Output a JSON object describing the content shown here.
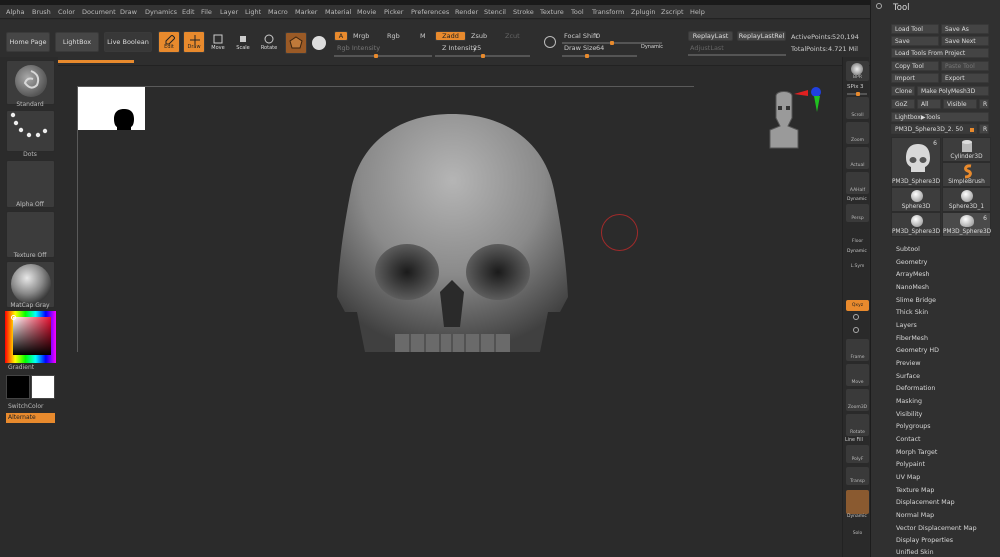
{
  "colors": {
    "accent": "#e88a2d",
    "background": "#2b2b2b",
    "panel": "#303030",
    "axis_red": "#e02020",
    "axis_green": "#20c020",
    "axis_blue": "#2040e0"
  },
  "menubar": {
    "items": [
      "Alpha",
      "Brush",
      "Color",
      "Document",
      "Draw",
      "Dynamics",
      "Edit",
      "File",
      "Layer",
      "Light",
      "Macro",
      "Marker",
      "Material",
      "Movie",
      "Picker",
      "Preferences",
      "Render",
      "Stencil",
      "Stroke",
      "Texture",
      "Tool",
      "Transform",
      "Zplugin",
      "Zscript",
      "Help"
    ]
  },
  "top_shelf": {
    "home_page": "Home Page",
    "lightbox": "LightBox",
    "live_boolean": "Live Boolean",
    "edit": "Edit",
    "draw": "Draw",
    "move": "Move",
    "scale": "Scale",
    "rotate": "Rotate",
    "a": "A",
    "mrgb": "Mrgb",
    "rgb": "Rgb",
    "m": "M",
    "rgb_intensity": "Rgb Intensity",
    "zadd": "Zadd",
    "zsub": "Zsub",
    "zcut": "Zcut",
    "z_intensity_label": "Z Intensity",
    "z_intensity_value": "25",
    "focal_shift_label": "Focal Shift",
    "focal_shift_value": "0",
    "draw_size_label": "Draw Size",
    "draw_size_value": "64",
    "dynamic": "Dynamic",
    "replay_last": "ReplayLast",
    "replay_last_rel": "ReplayLastRel",
    "adjust_last": "AdjustLast",
    "active_points_label": "ActivePoints:",
    "active_points_value": "520,194",
    "total_points_label": "TotalPoints:",
    "total_points_value": "4.721 Mil"
  },
  "left_shelf": {
    "brush": "Standard",
    "stroke": "Dots",
    "alpha": "Alpha Off",
    "texture": "Texture Off",
    "material": "MatCap Gray",
    "gradient": "Gradient",
    "switch_color": "SwitchColor",
    "alternate": "Alternate"
  },
  "right_shelf": {
    "bpr": "BPR",
    "spix_label": "SPix",
    "spix_value": "3",
    "scroll": "Scroll",
    "zoom": "Zoom",
    "actual": "Actual",
    "aahalf": "AAHalf",
    "dynamic": "Dynamic",
    "persp": "Persp",
    "floor": "Floor",
    "dynamic2": "Dynamic",
    "lsym": "L.Sym",
    "xyz": "Qxyz",
    "frame": "Frame",
    "move": "Move",
    "zoom3d": "Zoom3D",
    "rotate": "Rotate",
    "line_fill": "Line Fill",
    "polyf": "PolyF",
    "transp": "Transp",
    "dynamic3": "Dynamic",
    "solo": "Solo"
  },
  "tool_panel": {
    "title": "Tool",
    "load_tool": "Load Tool",
    "save_as": "Save As",
    "save": "Save",
    "save_next": "Save Next",
    "load_tools_from_project": "Load Tools From Project",
    "copy_tool": "Copy Tool",
    "paste_tool": "Paste Tool",
    "import": "Import",
    "export": "Export",
    "clone": "Clone",
    "make_polymesh": "Make PolyMesh3D",
    "goz": "GoZ",
    "all": "All",
    "visible": "Visible",
    "r": "R",
    "lightbox_tools": "Lightbox▶Tools",
    "current_tool": "PM3D_Sphere3D_2. 50",
    "tiles": [
      {
        "label": "PM3D_Sphere3D",
        "count": "6"
      },
      {
        "label": "Cylinder3D",
        "count": ""
      },
      {
        "label": "SimpleBrush",
        "count": ""
      },
      {
        "label": "Sphere3D",
        "count": ""
      },
      {
        "label": "Sphere3D_1",
        "count": ""
      },
      {
        "label": "PM3D_Sphere3D",
        "count": ""
      },
      {
        "label": "PM3D_Sphere3D",
        "count": "6"
      }
    ],
    "subpalettes": [
      "Subtool",
      "Geometry",
      "ArrayMesh",
      "NanoMesh",
      "Slime Bridge",
      "Thick Skin",
      "Layers",
      "FiberMesh",
      "Geometry HD",
      "Preview",
      "Surface",
      "Deformation",
      "Masking",
      "Visibility",
      "Polygroups",
      "Contact",
      "Morph Target",
      "Polypaint",
      "UV Map",
      "Texture Map",
      "Displacement Map",
      "Normal Map",
      "Vector Displacement Map",
      "Display Properties",
      "Unified Skin"
    ]
  }
}
